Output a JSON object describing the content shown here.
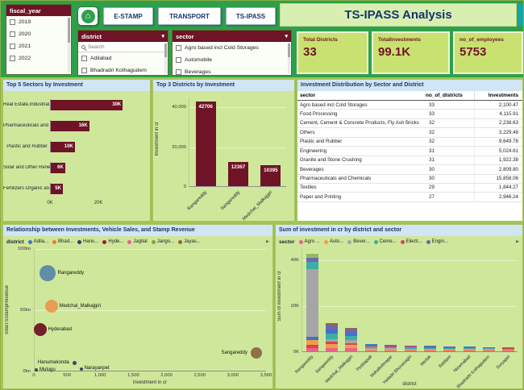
{
  "theme": {
    "green": "#2ea04c",
    "canvas": "#a9cf55",
    "panel": "#cfe79b",
    "maroon": "#6e1426",
    "navy": "#17356b",
    "headerblue": "#d2e5f4",
    "card": "#c9e170",
    "teal": "#18a3a0"
  },
  "icons": {
    "home": "⌂",
    "chevron_down": "▾",
    "legend_scroll_arrow": "▶"
  },
  "topbar": {
    "title": "TS-IPASS Analysis",
    "buttons": [
      "E-STAMP",
      "TRANSPORT",
      "TS-IPASS"
    ]
  },
  "slicers": {
    "fiscal_year": {
      "label": "fiscal_year",
      "options": [
        "2019",
        "2020",
        "2021",
        "2022"
      ]
    },
    "district": {
      "label": "district",
      "search_placeholder": "Search",
      "options": [
        "Adilabad",
        "Bhadradri Kothagudem"
      ]
    },
    "sector": {
      "label": "sector",
      "options": [
        "Agro based incl Cold Storages",
        "Automobile",
        "Beverages"
      ]
    }
  },
  "kpis": [
    {
      "label": "Total Districts",
      "value": "33"
    },
    {
      "label": "TotalInvestments",
      "value": "99.1K"
    },
    {
      "label": "no_of_employees",
      "value": "5753"
    }
  ],
  "chart_data": [
    {
      "id": "top5_sectors",
      "type": "bar",
      "orientation": "horizontal",
      "title": "Top 5 Sectors by Investment",
      "categories": [
        "Real Estate,Industrial...",
        "Pharmaceuticals and ...",
        "Plastic and Rubber",
        "Solar and Other Rene...",
        "Fertilizers Organic an..."
      ],
      "values": [
        30000,
        16000,
        10000,
        6000,
        5000
      ],
      "value_labels": [
        "30K",
        "16K",
        "10K",
        "6K",
        "5K"
      ],
      "x_ticks": [
        "0K",
        "20K"
      ],
      "x_tick_values": [
        0,
        20000
      ],
      "xlim": [
        0,
        40000
      ],
      "bar_color": "#6e1426"
    },
    {
      "id": "top3_districts",
      "type": "bar",
      "orientation": "vertical",
      "title": "Top 3 Districts by Investment",
      "categories": [
        "Rangareddy",
        "Sangareddy",
        "Medchal_Malkajgiri"
      ],
      "values": [
        42706,
        12367,
        10395
      ],
      "value_labels": [
        "42706",
        "12367",
        "10395"
      ],
      "ylabel": "Investment in cr",
      "y_ticks": [
        "0",
        "20,000",
        "40,000"
      ],
      "y_tick_values": [
        0,
        20000,
        40000
      ],
      "ylim": [
        0,
        45000
      ],
      "bar_color": "#6e1426"
    },
    {
      "id": "sector_district_table",
      "type": "table",
      "title": "Investment Distribution by Sector and District",
      "columns": [
        "sector",
        "no_of_districts",
        "Investments"
      ],
      "rows": [
        [
          "Agro based incl Cold Storages",
          "33",
          "2,100.47"
        ],
        [
          "Food Processing",
          "33",
          "4,115.91"
        ],
        [
          "Cement, Cement & Concrete Products, Fly Ash Bricks",
          "32",
          "2,238.63"
        ],
        [
          "Others",
          "32",
          "3,229.48"
        ],
        [
          "Plastic and Rubber",
          "32",
          "9,649.78"
        ],
        [
          "Engineering",
          "31",
          "5,024.61"
        ],
        [
          "Granite and Stone Crushing",
          "31",
          "1,922.38"
        ],
        [
          "Beverages",
          "30",
          "2,809.80"
        ],
        [
          "Pharmaceuticals and Chemicals",
          "30",
          "15,858.06"
        ],
        [
          "Textiles",
          "29",
          "1,844.27"
        ],
        [
          "Paper and Printing",
          "27",
          "2,946.24"
        ]
      ]
    },
    {
      "id": "investment_stamp_scatter",
      "type": "scatter",
      "title": "Relationship between Investments, Vehicle Sales, and Stamp Revenue",
      "legend_title": "district",
      "legend_items": [
        {
          "label": "Adila...",
          "color": "#4472c4"
        },
        {
          "label": "Bhad...",
          "color": "#ed7d31"
        },
        {
          "label": "Hanu...",
          "color": "#264478"
        },
        {
          "label": "Hyde...",
          "color": "#9e1b32"
        },
        {
          "label": "Jagtial",
          "color": "#e8638c"
        },
        {
          "label": "Jango...",
          "color": "#70ad47"
        },
        {
          "label": "Jayas...",
          "color": "#8a6a45"
        }
      ],
      "xlabel": "investment in cr",
      "ylabel": "TotalTSStampRevenue",
      "x_ticks": [
        "0",
        "500",
        "1,000",
        "1,500",
        "2,000",
        "2,500",
        "3,000",
        "3,500"
      ],
      "y_ticks": [
        "0bn",
        "50bn",
        "100bn"
      ],
      "y_tick_values": [
        0,
        50,
        100
      ],
      "xlim": [
        0,
        3500
      ],
      "ylim": [
        0,
        100
      ],
      "points": [
        {
          "label": "Rangareddy",
          "x": 200,
          "y": 80,
          "r": 10,
          "color": "#5b89a6",
          "side": "right"
        },
        {
          "label": "Medchal_Malkajgiri",
          "x": 250,
          "y": 53,
          "r": 8,
          "color": "#e79a50",
          "side": "right"
        },
        {
          "label": "Hyderabad",
          "x": 80,
          "y": 34,
          "r": 8,
          "color": "#6e1426",
          "side": "right"
        },
        {
          "label": "Hanumakonda",
          "x": 600,
          "y": 7,
          "r": 2.5,
          "color": "#3a3a5c",
          "side": "left"
        },
        {
          "label": "Mulugu",
          "x": 25,
          "y": 1,
          "r": 2,
          "color": "#3a3a5c",
          "side": "right"
        },
        {
          "label": "Narayanpet",
          "x": 700,
          "y": 2,
          "r": 2,
          "color": "#3a3a5c",
          "side": "right"
        },
        {
          "label": "Sangareddy",
          "x": 3340,
          "y": 15,
          "r": 7,
          "color": "#8a6a45",
          "side": "left"
        }
      ]
    },
    {
      "id": "district_sector_stacked",
      "type": "bar",
      "subtype": "stacked",
      "title": "Sum of investment in cr by district and sector",
      "legend_title": "sector",
      "legend_items": [
        {
          "label": "Agro ...",
          "color": "#e8638c"
        },
        {
          "label": "Auto...",
          "color": "#f29c4a"
        },
        {
          "label": "Bever...",
          "color": "#a5a5a5"
        },
        {
          "label": "Ceme...",
          "color": "#3caea3"
        },
        {
          "label": "Electr...",
          "color": "#d64550"
        },
        {
          "label": "Engin...",
          "color": "#6f63bb"
        }
      ],
      "xlabel": "district",
      "ylabel": "Sum of investment in cr",
      "y_ticks": [
        "0K",
        "20K",
        "40K"
      ],
      "y_tick_values": [
        0,
        20000,
        40000
      ],
      "ylim": [
        0,
        45000
      ],
      "bars": [
        {
          "label": "Rangareddy",
          "segments": [
            [
              "#e8638c",
              1500
            ],
            [
              "#d64550",
              1200
            ],
            [
              "#f29c4a",
              2300
            ],
            [
              "#4472c4",
              1200
            ],
            [
              "#a5a5a5",
              29500
            ],
            [
              "#3caea3",
              3200
            ],
            [
              "#6f63bb",
              2000
            ],
            [
              "#8fbc5a",
              1806
            ]
          ]
        },
        {
          "label": "Sangareddy",
          "segments": [
            [
              "#e8638c",
              1500
            ],
            [
              "#f29c4a",
              1700
            ],
            [
              "#d64550",
              900
            ],
            [
              "#a5a5a5",
              1300
            ],
            [
              "#3caea3",
              2500
            ],
            [
              "#4472c4",
              1600
            ],
            [
              "#6f63bb",
              1800
            ],
            [
              "#8a6a45",
              1067
            ]
          ]
        },
        {
          "label": "Medchal_Malkajgiri",
          "segments": [
            [
              "#e8638c",
              1300
            ],
            [
              "#f29c4a",
              1400
            ],
            [
              "#d64550",
              1000
            ],
            [
              "#a5a5a5",
              1200
            ],
            [
              "#3caea3",
              1700
            ],
            [
              "#4472c4",
              1400
            ],
            [
              "#6f63bb",
              1395
            ],
            [
              "#8a6a45",
              1000
            ]
          ]
        },
        {
          "label": "Peddapalli",
          "segments": [
            [
              "#e8638c",
              500
            ],
            [
              "#f29c4a",
              500
            ],
            [
              "#a5a5a5",
              400
            ],
            [
              "#3caea3",
              600
            ],
            [
              "#d64550",
              400
            ],
            [
              "#6f63bb",
              450
            ],
            [
              "#4472c4",
              350
            ]
          ]
        },
        {
          "label": "Mahabubnagar",
          "segments": [
            [
              "#e8638c",
              450
            ],
            [
              "#f29c4a",
              450
            ],
            [
              "#a5a5a5",
              380
            ],
            [
              "#3caea3",
              500
            ],
            [
              "#d64550",
              380
            ],
            [
              "#6f63bb",
              400
            ],
            [
              "#4472c4",
              340
            ]
          ]
        },
        {
          "label": "Yadadri Bhuvanagiri",
          "segments": [
            [
              "#e8638c",
              420
            ],
            [
              "#f29c4a",
              420
            ],
            [
              "#a5a5a5",
              350
            ],
            [
              "#3caea3",
              450
            ],
            [
              "#d64550",
              340
            ],
            [
              "#6f63bb",
              370
            ],
            [
              "#4472c4",
              250
            ]
          ]
        },
        {
          "label": "Medak",
          "segments": [
            [
              "#e8638c",
              400
            ],
            [
              "#f29c4a",
              380
            ],
            [
              "#a5a5a5",
              330
            ],
            [
              "#3caea3",
              420
            ],
            [
              "#d64550",
              300
            ],
            [
              "#6f63bb",
              340
            ],
            [
              "#4472c4",
              230
            ]
          ]
        },
        {
          "label": "Siddipet",
          "segments": [
            [
              "#e8638c",
              380
            ],
            [
              "#f29c4a",
              360
            ],
            [
              "#a5a5a5",
              310
            ],
            [
              "#3caea3",
              390
            ],
            [
              "#d64550",
              280
            ],
            [
              "#6f63bb",
              320
            ],
            [
              "#4472c4",
              210
            ]
          ]
        },
        {
          "label": "Nizamabad",
          "segments": [
            [
              "#e8638c",
              360
            ],
            [
              "#f29c4a",
              340
            ],
            [
              "#a5a5a5",
              290
            ],
            [
              "#3caea3",
              360
            ],
            [
              "#d64550",
              260
            ],
            [
              "#6f63bb",
              300
            ],
            [
              "#4472c4",
              190
            ]
          ]
        },
        {
          "label": "Bhadradri Kothagudem",
          "segments": [
            [
              "#e8638c",
              340
            ],
            [
              "#f29c4a",
              320
            ],
            [
              "#a5a5a5",
              270
            ],
            [
              "#3caea3",
              330
            ],
            [
              "#d64550",
              240
            ],
            [
              "#6f63bb",
              280
            ],
            [
              "#4472c4",
              170
            ]
          ]
        },
        {
          "label": "Suryapet",
          "segments": [
            [
              "#e8638c",
              320
            ],
            [
              "#f29c4a",
              300
            ],
            [
              "#a5a5a5",
              250
            ],
            [
              "#3caea3",
              300
            ],
            [
              "#d64550",
              220
            ],
            [
              "#6f63bb",
              260
            ],
            [
              "#4472c4",
              150
            ]
          ]
        }
      ]
    }
  ]
}
